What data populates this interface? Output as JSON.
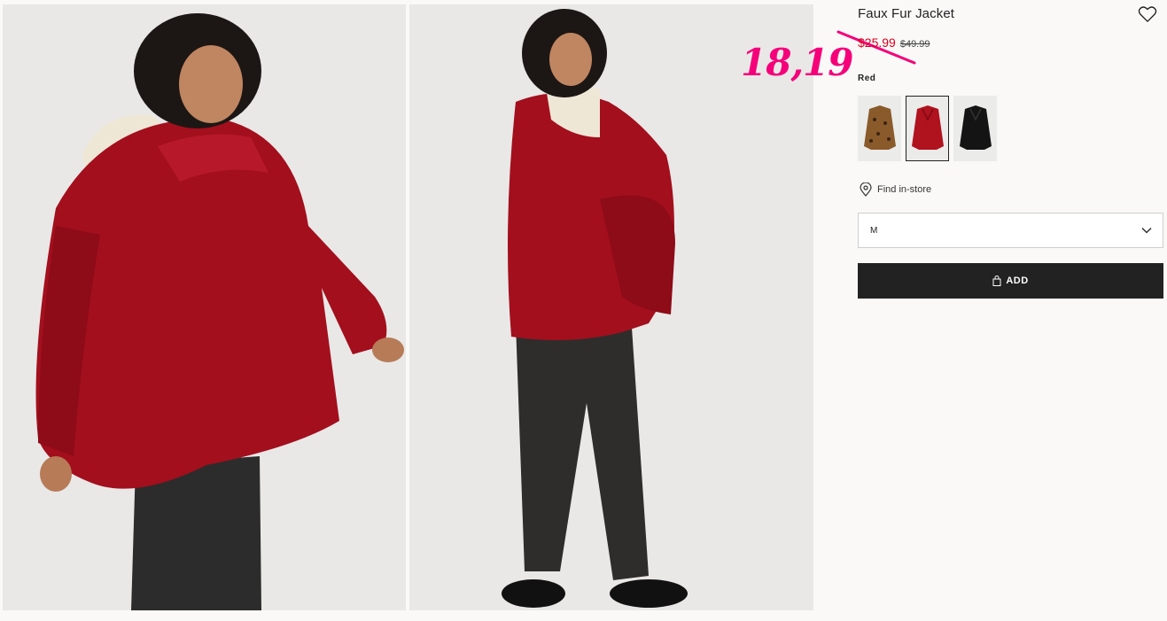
{
  "product": {
    "title": "Faux Fur Jacket",
    "sale_price": "$25.99",
    "original_price": "$49.99",
    "color_label": "Red",
    "swatches": [
      {
        "name": "leopard",
        "color": "#8a5a2b"
      },
      {
        "name": "red",
        "color": "#b0121e",
        "selected": true
      },
      {
        "name": "black",
        "color": "#141414"
      }
    ],
    "find_in_store": "Find in-store",
    "size_value": "M",
    "add_label": "ADD"
  },
  "annotation": {
    "handwritten_price": "18,19",
    "color": "#f5007a"
  },
  "colors": {
    "accent_sale": "#d6001c",
    "button_bg": "#222222",
    "page_bg": "#faf9f8"
  }
}
